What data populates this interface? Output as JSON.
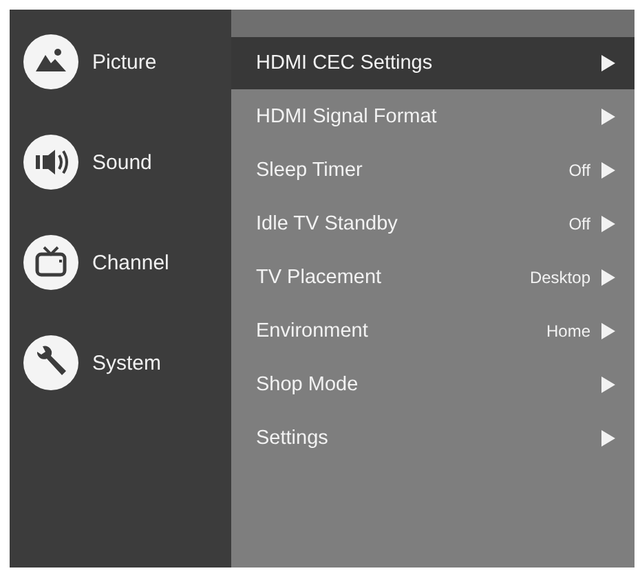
{
  "sidebar": {
    "items": [
      {
        "label": "Picture",
        "kind": "picture"
      },
      {
        "label": "Sound",
        "kind": "sound"
      },
      {
        "label": "Channel",
        "kind": "channel"
      },
      {
        "label": "System",
        "kind": "system"
      }
    ]
  },
  "menu": {
    "items": [
      {
        "label": "HDMI CEC Settings",
        "selected": true
      },
      {
        "label": "HDMI Signal Format",
        "selected": false
      },
      {
        "label": "Sleep Timer",
        "value": "Off",
        "selected": false
      },
      {
        "label": "Idle TV Standby",
        "value": "Off",
        "selected": false
      },
      {
        "label": "TV Placement",
        "value": "Desktop",
        "selected": false
      },
      {
        "label": "Environment",
        "value": "Home",
        "selected": false
      },
      {
        "label": "Shop Mode",
        "selected": false
      },
      {
        "label": "Settings",
        "selected": false
      }
    ]
  }
}
